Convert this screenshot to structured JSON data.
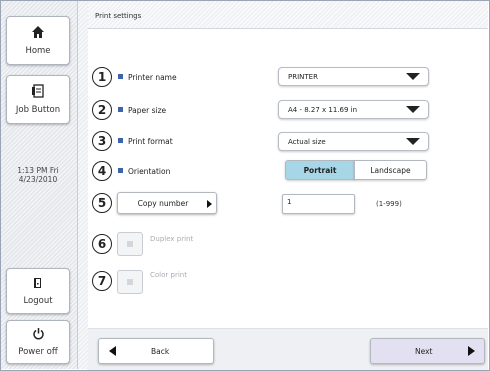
{
  "sidebar": {
    "home_label": "Home",
    "job_label": "Job Button",
    "clock_time": "1:13 PM  Fri",
    "clock_date": "4/23/2010",
    "logout_label": "Logout",
    "poweroff_label": "Power off"
  },
  "header": {
    "title": "Print settings"
  },
  "settings": {
    "printer": {
      "number": "1",
      "label": "Printer name",
      "value": "PRINTER"
    },
    "paper": {
      "number": "2",
      "label": "Paper size",
      "value": "A4 - 8.27 x 11.69 in"
    },
    "format": {
      "number": "3",
      "label": "Print format",
      "value": "Actual size"
    },
    "orientation": {
      "number": "4",
      "label": "Orientation",
      "options": [
        "Portrait",
        "Landscape"
      ],
      "selected": "Portrait"
    },
    "copies": {
      "number": "5",
      "button_label": "Copy number",
      "value": "1",
      "range": "(1-999)"
    },
    "duplex": {
      "number": "6",
      "label": "Duplex print",
      "enabled": false
    },
    "color": {
      "number": "7",
      "label": "Color print",
      "enabled": false
    }
  },
  "footer": {
    "back_label": "Back",
    "next_label": "Next"
  },
  "colors": {
    "accent": "#3d63b0",
    "selected_segment": "#a7d6e6",
    "next_button": "#e3e1f1"
  }
}
